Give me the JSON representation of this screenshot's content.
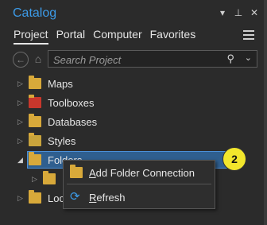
{
  "window": {
    "title": "Catalog",
    "controls": [
      "chevron-down",
      "pin",
      "close"
    ]
  },
  "tabs": [
    {
      "label": "Project",
      "active": true
    },
    {
      "label": "Portal",
      "active": false
    },
    {
      "label": "Computer",
      "active": false
    },
    {
      "label": "Favorites",
      "active": false
    }
  ],
  "search": {
    "placeholder": "Search Project"
  },
  "tree": {
    "items": [
      {
        "label": "Maps",
        "icon": "maps-folder-icon"
      },
      {
        "label": "Toolboxes",
        "icon": "toolbox-folder-icon"
      },
      {
        "label": "Databases",
        "icon": "database-folder-icon"
      },
      {
        "label": "Styles",
        "icon": "styles-folder-icon"
      },
      {
        "label": "Folders",
        "icon": "folder-icon",
        "selected": true,
        "expanded": true
      },
      {
        "label": "Loc",
        "icon": "locators-folder-icon"
      }
    ]
  },
  "badge": {
    "text": "2",
    "color": "#f2e62c"
  },
  "context_menu": {
    "items": [
      {
        "label": "Add Folder Connection",
        "icon": "add-folder-icon"
      },
      {
        "label": "Refresh",
        "icon": "refresh-icon"
      }
    ]
  },
  "colors": {
    "accent": "#3c9be8",
    "selection": "#2f5f8f",
    "folder": "#d8a93a"
  }
}
